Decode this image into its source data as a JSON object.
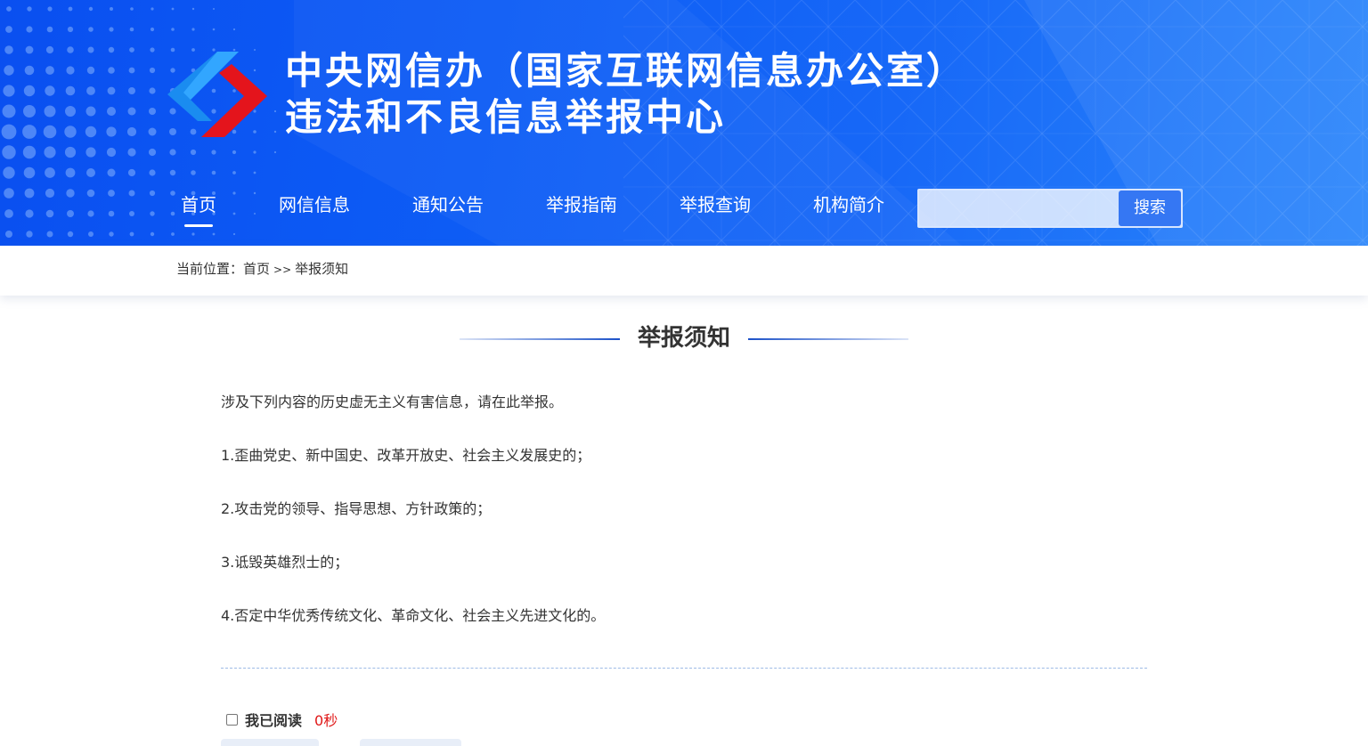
{
  "header": {
    "title_line1": "中央网信办（国家互联网信息办公室）",
    "title_line2": "违法和不良信息举报中心",
    "logo_colors": {
      "blue": "#1a8cf0",
      "red": "#e4141c"
    }
  },
  "nav": {
    "items": [
      {
        "label": "首页",
        "active": true
      },
      {
        "label": "网信信息",
        "active": false
      },
      {
        "label": "通知公告",
        "active": false
      },
      {
        "label": "举报指南",
        "active": false
      },
      {
        "label": "举报查询",
        "active": false
      },
      {
        "label": "机构简介",
        "active": false
      }
    ]
  },
  "search": {
    "value": "",
    "placeholder": "",
    "button_label": "搜索"
  },
  "breadcrumb": {
    "prefix": "当前位置：",
    "home": "首页",
    "separator": ">>",
    "current": "举报须知"
  },
  "main": {
    "title": "举报须知",
    "intro": "涉及下列内容的历史虚无主义有害信息，请在此举报。",
    "items": [
      {
        "num": "1.",
        "text": "歪曲党史、新中国史、改革开放史、社会主义发展史的；"
      },
      {
        "num": "2.",
        "text": "攻击党的领导、指导思想、方针政策的；"
      },
      {
        "num": "3.",
        "text": "诋毁英雄烈士的；"
      },
      {
        "num": "4.",
        "text": "否定中华优秀传统文化、革命文化、社会主义先进文化的。"
      }
    ],
    "read_label": "我已阅读",
    "timer": "0秒"
  },
  "colors": {
    "header_blue": "#0d5cf5",
    "search_button": "#3577f3",
    "timer_red": "#e01818",
    "title_line": "#1a50c8"
  }
}
